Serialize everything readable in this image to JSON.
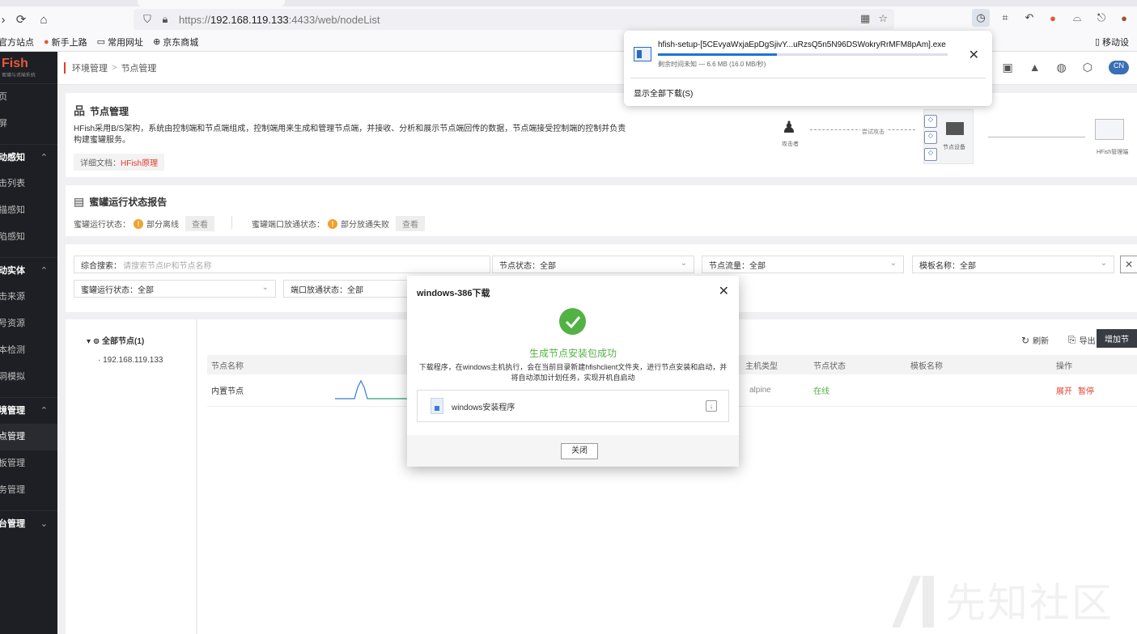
{
  "browser": {
    "url_scheme": "https://",
    "url_host": "192.168.119.133",
    "url_rest": ":4433/web/nodeList",
    "bookmarks": [
      "官方站点",
      "新手上路",
      "常用网址",
      "京东商城"
    ],
    "mobile_bookmark": "移动设"
  },
  "app": {
    "logo": "Fish",
    "logo_sub": "蜜罐与诱捕系统"
  },
  "sidebar": {
    "items_top": [
      "页",
      "屏"
    ],
    "group1": "动感知",
    "group1_items": [
      "击列表",
      "描感知",
      "陷感知"
    ],
    "group2": "动实体",
    "group2_items": [
      "击来源",
      "号资源",
      "本检测",
      "洞模拟"
    ],
    "group3": "境管理",
    "group3_items": [
      "点管理",
      "板管理",
      "务管理"
    ],
    "group4": "台管理"
  },
  "topbar": {
    "crumb1": "环境管理",
    "crumb_sep": ">",
    "crumb2": "节点管理",
    "lang": "CN"
  },
  "intro": {
    "title": "节点管理",
    "desc": "HFish采用B/S架构，系统由控制端和节点端组成，控制端用来生成和管理节点端，并接收、分析和展示节点端回传的数据，节点端接受控制端的控制并负责构建蜜罐服务。",
    "doc_label": "详细文档：",
    "doc_link": "HFish原理",
    "diagram": {
      "attacker": "攻击者",
      "attempt": "尝试攻击",
      "node": "节点设备",
      "server": "HFish管理端"
    }
  },
  "report": {
    "title": "蜜罐运行状态报告",
    "run_label": "蜜罐运行状态：",
    "run_value": "部分离线",
    "port_label": "蜜罐端口放通状态：",
    "port_value": "部分放通失败",
    "view": "查看"
  },
  "filters": {
    "search_label": "综合搜索：",
    "search_placeholder": "请搜索节点IP和节点名称",
    "node_status": "节点状态：全部",
    "node_flow": "节点流量：全部",
    "template": "模板名称：全部",
    "honeypot_status": "蜜罐运行状态：全部",
    "port_status": "端口放通状态：全部"
  },
  "tree": {
    "root": "全部节点(1)",
    "leaf": "192.168.119.133"
  },
  "table": {
    "actions": {
      "refresh": "刷新",
      "export": "导出",
      "add": "增加节"
    },
    "headers": [
      "节点名称",
      "主机类型",
      "节点状态",
      "模板名称",
      "操作"
    ],
    "row": {
      "name": "内置节点",
      "host": "alpine",
      "status": "在线",
      "op1": "展开",
      "op2": "暂停"
    }
  },
  "download_panel": {
    "filename": "hfish-setup-[5CEvyaWxjaEpDgSjivY...uRzsQ5n5N96DSWokryRrMFM8pAm].exe",
    "meta": "剩余时间未知 — 6.6 MB (16.0 MB/秒)",
    "progress": 0.41,
    "show_all": "显示全部下载(S)"
  },
  "modal": {
    "title": "windows-386下载",
    "success": "生成节点安装包成功",
    "message": "下载程序，在windows主机执行，会在当前目录新建hfishclient文件夹，进行节点安装和启动，并将自动添加计划任务，实现开机自启动",
    "file_label": "windows安装程序",
    "close": "关闭"
  },
  "watermark": "先知社区",
  "colors": {
    "accent": "#e23d2b",
    "success": "#52b243",
    "warn": "#f0a22c",
    "progress": "#1e73d8",
    "sidebar": "#1e1f24"
  }
}
